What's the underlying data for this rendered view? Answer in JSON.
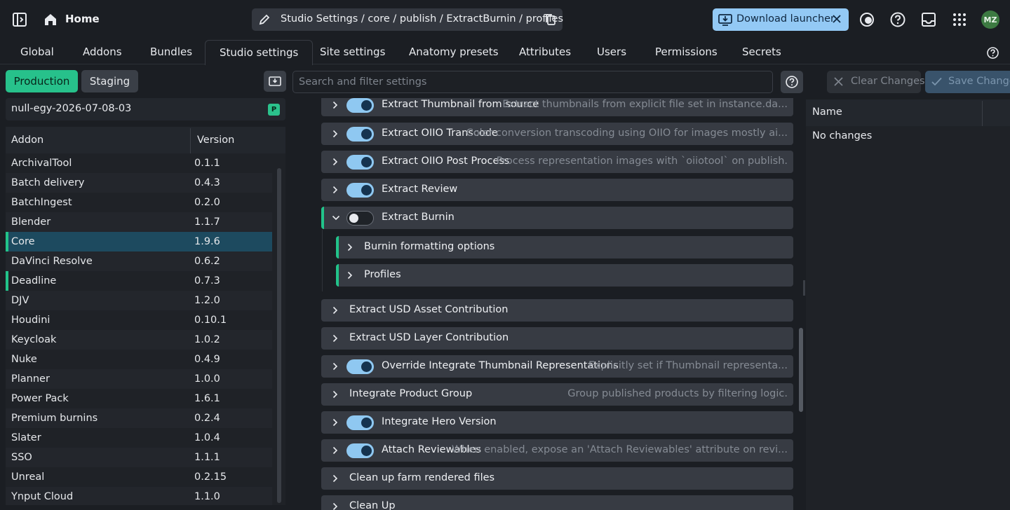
{
  "header": {
    "home_label": "Home",
    "breadcrumb": "Studio Settings / core / publish / ExtractBurnin / profiles",
    "download_label": "Download launcher",
    "avatar_initials": "MZ",
    "icons": [
      "sidebar-toggle-icon",
      "home-icon",
      "pencil-icon",
      "copy-icon",
      "download-icon",
      "close-icon",
      "chat-icon",
      "help-icon",
      "inbox-icon",
      "apps-grid-icon"
    ]
  },
  "tabs": [
    {
      "label": "Global"
    },
    {
      "label": "Addons"
    },
    {
      "label": "Bundles"
    },
    {
      "label": "Studio settings",
      "active": true
    },
    {
      "label": "Site settings"
    },
    {
      "label": "Anatomy presets"
    },
    {
      "label": "Attributes"
    },
    {
      "label": "Users"
    },
    {
      "label": "Permissions"
    },
    {
      "label": "Secrets"
    }
  ],
  "left": {
    "production_label": "Production",
    "staging_label": "Staging",
    "bundle_name": "null-egy-2026-07-08-03",
    "bundle_badge": "P",
    "addon_header": "Addon",
    "version_header": "Version",
    "addons": [
      {
        "name": "ArchivalTool",
        "version": "0.1.1"
      },
      {
        "name": "Batch delivery",
        "version": "0.4.3"
      },
      {
        "name": "BatchIngest",
        "version": "0.2.0"
      },
      {
        "name": "Blender",
        "version": "1.1.7"
      },
      {
        "name": "Core",
        "version": "1.9.6",
        "selected": true,
        "changed": true
      },
      {
        "name": "DaVinci Resolve",
        "version": "0.6.2"
      },
      {
        "name": "Deadline",
        "version": "0.7.3",
        "changed": true
      },
      {
        "name": "DJV",
        "version": "1.2.0"
      },
      {
        "name": "Houdini",
        "version": "0.10.1"
      },
      {
        "name": "Keycloak",
        "version": "1.0.2"
      },
      {
        "name": "Nuke",
        "version": "0.4.9"
      },
      {
        "name": "Planner",
        "version": "1.0.0"
      },
      {
        "name": "Power Pack",
        "version": "1.6.1"
      },
      {
        "name": "Premium burnins",
        "version": "0.2.4"
      },
      {
        "name": "Slater",
        "version": "1.0.4"
      },
      {
        "name": "SSO",
        "version": "1.1.1"
      },
      {
        "name": "Unreal",
        "version": "0.2.15"
      },
      {
        "name": "Ynput Cloud",
        "version": "1.1.0"
      }
    ]
  },
  "toolbar": {
    "search_placeholder": "Search and filter settings",
    "clear_label": "Clear Changes",
    "save_label": "Save Changes"
  },
  "settings": [
    {
      "label": "Extract Thumbnail from source",
      "desc": "Extract thumbnails from explicit file set in instance.da...",
      "toggle": "on"
    },
    {
      "label": "Extract OIIO Transcode",
      "desc": "Color conversion transcoding using OIIO for images mostly ai...",
      "toggle": "on"
    },
    {
      "label": "Extract OIIO Post Process",
      "desc": "Process representation images with `oiiotool` on publish.",
      "toggle": "on"
    },
    {
      "label": "Extract Review",
      "desc": "",
      "toggle": "on"
    },
    {
      "label": "Extract Burnin",
      "desc": "",
      "toggle": "off",
      "expanded": true,
      "changed": true
    },
    {
      "label": "Burnin formatting options",
      "desc": "",
      "nested": true,
      "changed": true
    },
    {
      "label": "Profiles",
      "desc": "",
      "nested": true,
      "changed": true
    },
    {
      "label": "Extract USD Asset Contribution",
      "desc": ""
    },
    {
      "label": "Extract USD Layer Contribution",
      "desc": ""
    },
    {
      "label": "Override Integrate Thumbnail Representations",
      "desc": "Explicitly set if Thumbnail representa...",
      "toggle": "on"
    },
    {
      "label": "Integrate Product Group",
      "desc": "Group published products by filtering logic."
    },
    {
      "label": "Integrate Hero Version",
      "desc": "",
      "toggle": "on"
    },
    {
      "label": "Attach Reviewables",
      "desc": "When enabled, expose an 'Attach Reviewables' attribute on revi...",
      "toggle": "on"
    },
    {
      "label": "Clean up farm rendered files",
      "desc": ""
    },
    {
      "label": "Clean Up",
      "desc": ""
    }
  ],
  "changes": {
    "name_header": "Name",
    "empty_text": "No changes"
  },
  "colors": {
    "accent_green": "#22c38a",
    "accent_blue": "#93c9f5",
    "selected_row": "#1d4a5f",
    "background": "#1b1e23"
  }
}
